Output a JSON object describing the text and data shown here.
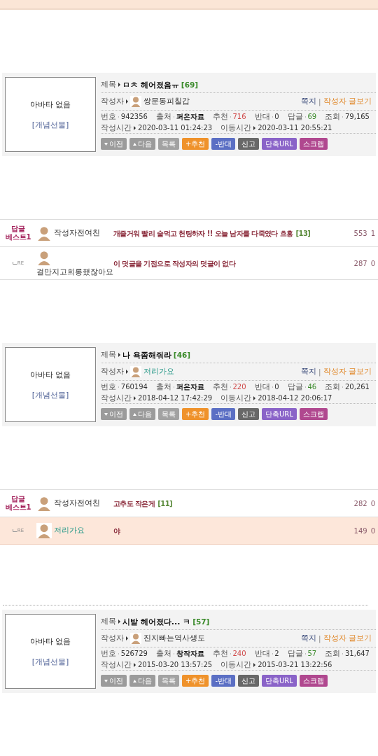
{
  "sections": [
    {
      "kind": "post",
      "avatar_box": {
        "text": "아바타 없음",
        "link": "[개념선물]"
      },
      "title_label": "제목",
      "title": "ㅁㅊ 헤어졌음ㅠ",
      "reply_count": "[69]",
      "author_label": "작성자",
      "author": {
        "name": "쌍문동피칠갑",
        "highlight_name": false
      },
      "message_link": "쪽지",
      "separator": "|",
      "posts_link": "작성자 글보기",
      "stats": [
        {
          "label": "번호",
          "value": "942356",
          "kind": "plain"
        },
        {
          "label": "출처",
          "value": "퍼온자료",
          "kind": "bold"
        },
        {
          "label": "추천",
          "value": "716",
          "kind": "red"
        },
        {
          "label": "반대",
          "value": "0",
          "kind": "plain"
        },
        {
          "label": "답글",
          "value": "69",
          "kind": "green"
        },
        {
          "label": "조회",
          "value": "79,165",
          "kind": "plain"
        }
      ],
      "times": [
        {
          "label": "작성시간",
          "value": "2020-03-11 01:24:23"
        },
        {
          "label": "이동시간",
          "value": "2020-03-11 20:55:21"
        }
      ],
      "buttons": [
        {
          "label": "이전",
          "kind": "prev",
          "color": "#9b9b9b"
        },
        {
          "label": "다음",
          "kind": "next",
          "color": "#9b9b9b"
        },
        {
          "label": "목록",
          "kind": "plain",
          "color": "#a2a2a2"
        },
        {
          "label": "+추천",
          "kind": "plain",
          "color": "#ef922b"
        },
        {
          "label": "-반대",
          "kind": "plain",
          "color": "#5b6fc4"
        },
        {
          "label": "신고",
          "kind": "plain",
          "color": "#686868"
        },
        {
          "label": "단축URL",
          "kind": "plain",
          "color": "#8a63c8"
        },
        {
          "label": "스크랩",
          "kind": "plain",
          "color": "#b0488f"
        }
      ]
    },
    {
      "kind": "comments",
      "rows": [
        {
          "kind": "best",
          "badge": "답글 베스트1",
          "author": {
            "name": "작성자전여친",
            "highlight_name": false
          },
          "text": "개즐거워 빨리 술먹고 헌팅하자 !! 오늘 남자를 다죽였다 흐흥",
          "count": "[13]",
          "likes": "553",
          "dislikes": "1",
          "highlighted": false
        },
        {
          "kind": "reply",
          "marker": "RE",
          "author": {
            "name": "걸만지고희롱했잖아요",
            "highlight_name": false,
            "stacked": true
          },
          "text": "이 덧글을 기점으로 작성자의 덧글이 없다",
          "likes": "287",
          "dislikes": "0",
          "highlighted": false
        }
      ]
    },
    {
      "kind": "post",
      "avatar_box": {
        "text": "아바타 없음",
        "link": "[개념선물]"
      },
      "title_label": "제목",
      "title": "나 욕좀해줘라",
      "reply_count": "[46]",
      "author_label": "작성자",
      "author": {
        "name": "저리가요",
        "highlight_name": true
      },
      "message_link": "쪽지",
      "separator": "|",
      "posts_link": "작성자 글보기",
      "stats": [
        {
          "label": "번호",
          "value": "760194",
          "kind": "plain"
        },
        {
          "label": "출처",
          "value": "퍼온자료",
          "kind": "bold"
        },
        {
          "label": "추천",
          "value": "220",
          "kind": "red"
        },
        {
          "label": "반대",
          "value": "0",
          "kind": "plain"
        },
        {
          "label": "답글",
          "value": "46",
          "kind": "green"
        },
        {
          "label": "조회",
          "value": "20,261",
          "kind": "plain"
        }
      ],
      "times": [
        {
          "label": "작성시간",
          "value": "2018-04-12 17:42:29"
        },
        {
          "label": "이동시간",
          "value": "2018-04-12 20:06:17"
        }
      ],
      "buttons": [
        {
          "label": "이전",
          "kind": "prev",
          "color": "#9b9b9b"
        },
        {
          "label": "다음",
          "kind": "next",
          "color": "#9b9b9b"
        },
        {
          "label": "목록",
          "kind": "plain",
          "color": "#a2a2a2"
        },
        {
          "label": "+추천",
          "kind": "plain",
          "color": "#ef922b"
        },
        {
          "label": "-반대",
          "kind": "plain",
          "color": "#5b6fc4"
        },
        {
          "label": "신고",
          "kind": "plain",
          "color": "#686868"
        },
        {
          "label": "단축URL",
          "kind": "plain",
          "color": "#8a63c8"
        },
        {
          "label": "스크랩",
          "kind": "plain",
          "color": "#b0488f"
        }
      ]
    },
    {
      "kind": "comments",
      "rows": [
        {
          "kind": "best",
          "badge": "답글 베스트1",
          "author": {
            "name": "작성자전여친",
            "highlight_name": false
          },
          "text": "고추도 작은게",
          "count": "[11]",
          "likes": "282",
          "dislikes": "0",
          "highlighted": false
        },
        {
          "kind": "reply",
          "marker": "RE",
          "author": {
            "name": "저리가요",
            "highlight_name": true,
            "stacked": false
          },
          "text": "야",
          "likes": "149",
          "dislikes": "0",
          "highlighted": true
        }
      ]
    },
    {
      "kind": "post",
      "divider": true,
      "avatar_box": {
        "text": "아바타 없음",
        "link": "[개념선물]"
      },
      "title_label": "제목",
      "title": "시발 헤어졌다... ㅋ",
      "reply_count": "[57]",
      "author_label": "작성자",
      "author": {
        "name": "진지빠는역사생도",
        "highlight_name": false
      },
      "message_link": "쪽지",
      "separator": "|",
      "posts_link": "작성자 글보기",
      "stats": [
        {
          "label": "번호",
          "value": "526729",
          "kind": "plain"
        },
        {
          "label": "출처",
          "value": "창작자료",
          "kind": "bold"
        },
        {
          "label": "추천",
          "value": "240",
          "kind": "red"
        },
        {
          "label": "반대",
          "value": "2",
          "kind": "plain"
        },
        {
          "label": "답글",
          "value": "57",
          "kind": "green"
        },
        {
          "label": "조회",
          "value": "31,647",
          "kind": "plain"
        }
      ],
      "times": [
        {
          "label": "작성시간",
          "value": "2015-03-20 13:57:25"
        },
        {
          "label": "이동시간",
          "value": "2015-03-21 13:22:56"
        }
      ],
      "buttons": [
        {
          "label": "이전",
          "kind": "prev",
          "color": "#9b9b9b"
        },
        {
          "label": "다음",
          "kind": "next",
          "color": "#9b9b9b"
        },
        {
          "label": "목록",
          "kind": "plain",
          "color": "#a2a2a2"
        },
        {
          "label": "+추천",
          "kind": "plain",
          "color": "#ef922b"
        },
        {
          "label": "-반대",
          "kind": "plain",
          "color": "#5b6fc4"
        },
        {
          "label": "신고",
          "kind": "plain",
          "color": "#686868"
        },
        {
          "label": "단축URL",
          "kind": "plain",
          "color": "#8a63c8"
        },
        {
          "label": "스크랩",
          "kind": "plain",
          "color": "#b0488f"
        }
      ]
    }
  ]
}
